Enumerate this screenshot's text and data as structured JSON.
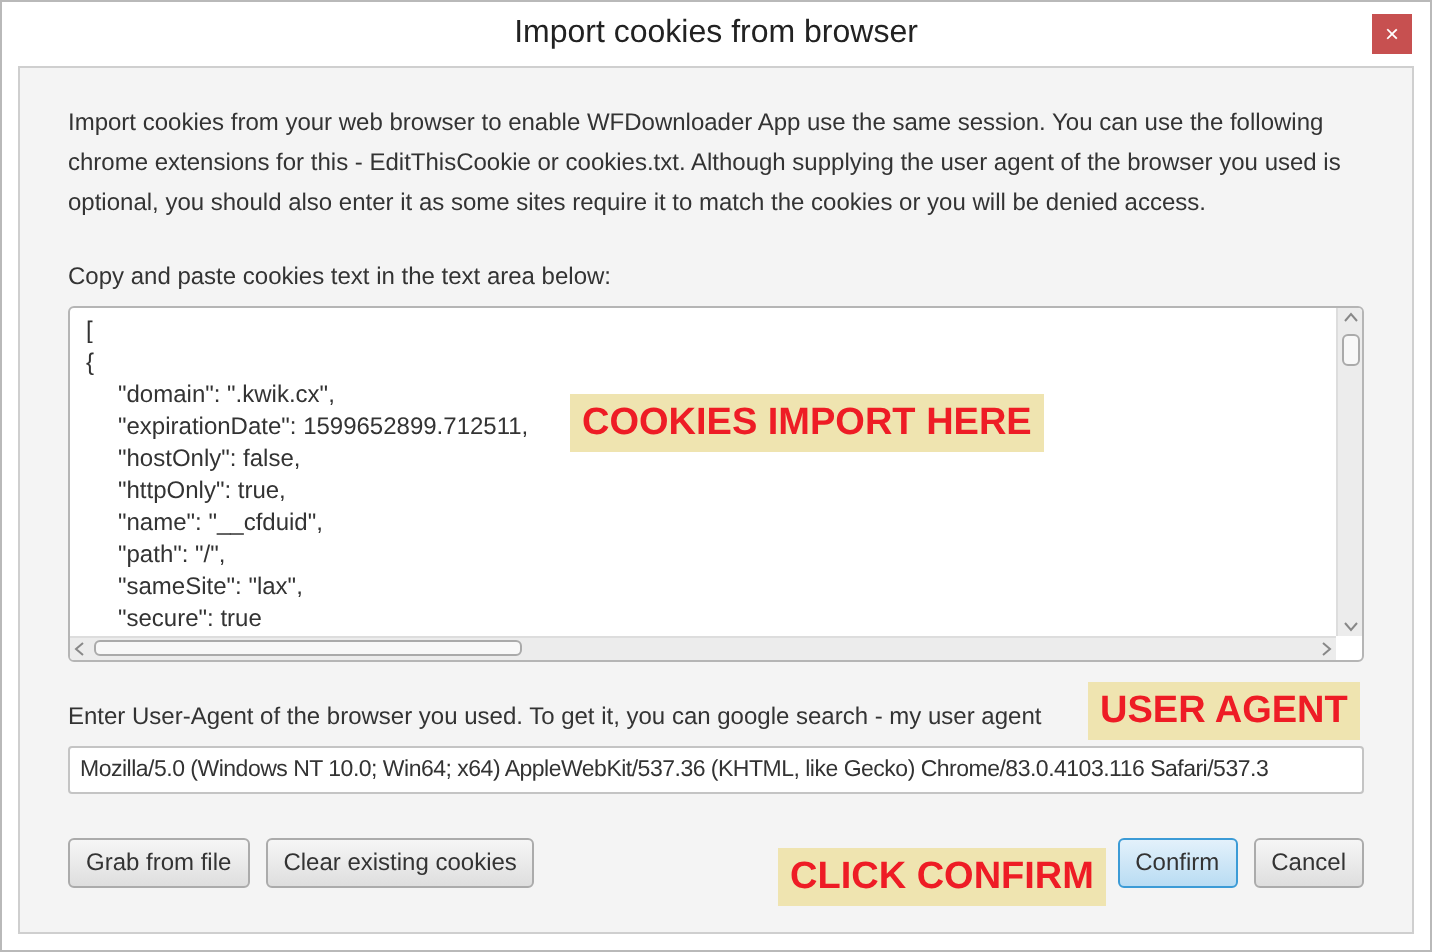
{
  "window": {
    "title": "Import cookies from browser",
    "close": "×"
  },
  "intro": "Import cookies from your web browser to enable WFDownloader App use the same session. You can use the following chrome extensions for this - EditThisCookie or cookies.txt. Although supplying the user agent of the browser you used is optional, you should also enter it as some sites require it to match the cookies or you will be denied access.",
  "cookies_label": "Copy and paste cookies text in the text area below:",
  "cookies_text": [
    {
      "text": "[",
      "indented": false
    },
    {
      "text": "{",
      "indented": false
    },
    {
      "text": "\"domain\": \".kwik.cx\",",
      "indented": true
    },
    {
      "text": "\"expirationDate\": 1599652899.712511,",
      "indented": true
    },
    {
      "text": "\"hostOnly\": false,",
      "indented": true
    },
    {
      "text": "\"httpOnly\": true,",
      "indented": true
    },
    {
      "text": "\"name\": \"__cfduid\",",
      "indented": true
    },
    {
      "text": "\"path\": \"/\",",
      "indented": true
    },
    {
      "text": "\"sameSite\": \"lax\",",
      "indented": true
    },
    {
      "text": "\"secure\": true",
      "indented": true
    }
  ],
  "user_agent_label": "Enter User-Agent of the browser you used. To get it, you can google search - my user agent",
  "user_agent": {
    "value": "Mozilla/5.0 (Windows NT 10.0; Win64; x64) AppleWebKit/537.36 (KHTML, like Gecko) Chrome/83.0.4103.116 Safari/537.3"
  },
  "buttons": [
    {
      "label": "Grab from file",
      "default": false
    },
    {
      "label": "Clear existing cookies",
      "default": false
    },
    {
      "label": "Confirm",
      "default": true
    },
    {
      "label": "Cancel",
      "default": false
    }
  ],
  "annotations": [
    {
      "text": "COOKIES IMPORT HERE"
    },
    {
      "text": "USER AGENT"
    },
    {
      "text": "CLICK CONFIRM"
    }
  ]
}
